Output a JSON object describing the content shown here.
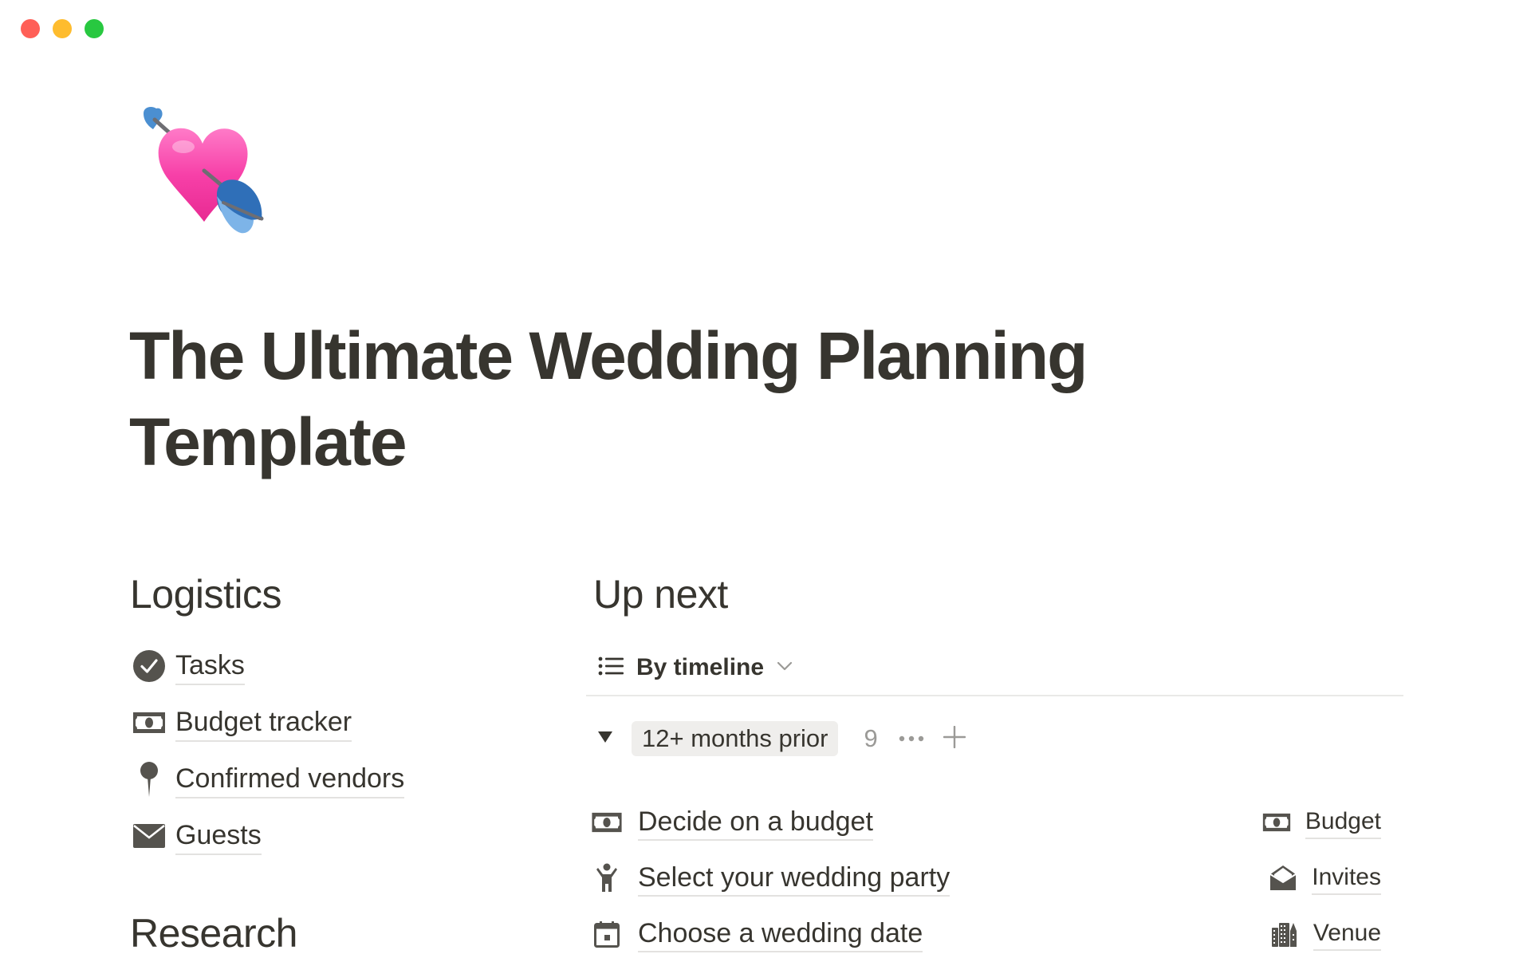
{
  "window": {
    "controls": [
      {
        "name": "close",
        "color": "#FF5F57"
      },
      {
        "name": "minimize",
        "color": "#FEBC2E"
      },
      {
        "name": "zoom",
        "color": "#28C840"
      }
    ]
  },
  "page": {
    "icon": "heart-with-arrow-emoji",
    "title": "The Ultimate Wedding Planning Template"
  },
  "logistics": {
    "heading": "Logistics",
    "items": [
      {
        "label": "Tasks",
        "icon": "check-circle-icon"
      },
      {
        "label": "Budget tracker",
        "icon": "money-bill-icon"
      },
      {
        "label": "Confirmed vendors",
        "icon": "pushpin-icon"
      },
      {
        "label": "Guests",
        "icon": "envelope-icon"
      }
    ]
  },
  "research": {
    "heading": "Research"
  },
  "up_next": {
    "heading": "Up next",
    "view": {
      "label": "By timeline",
      "icon": "list-icon"
    },
    "group": {
      "label": "12+ months prior",
      "count": "9",
      "pill_color": "#EFEEEC"
    },
    "tasks": [
      {
        "title": "Decide on a budget",
        "icon": "money-bill-icon",
        "category": "Budget",
        "category_icon": "money-bill-icon"
      },
      {
        "title": "Select your wedding party",
        "icon": "person-arms-up-icon",
        "category": "Invites",
        "category_icon": "open-envelope-icon"
      },
      {
        "title": "Choose a wedding date",
        "icon": "calendar-icon",
        "category": "Venue",
        "category_icon": "city-buildings-icon"
      }
    ]
  },
  "colors": {
    "text": "#37352F",
    "icon": "#55534E",
    "muted": "#9B9A97",
    "underline": "#E3E2E0",
    "divider": "#E9E9E7"
  }
}
